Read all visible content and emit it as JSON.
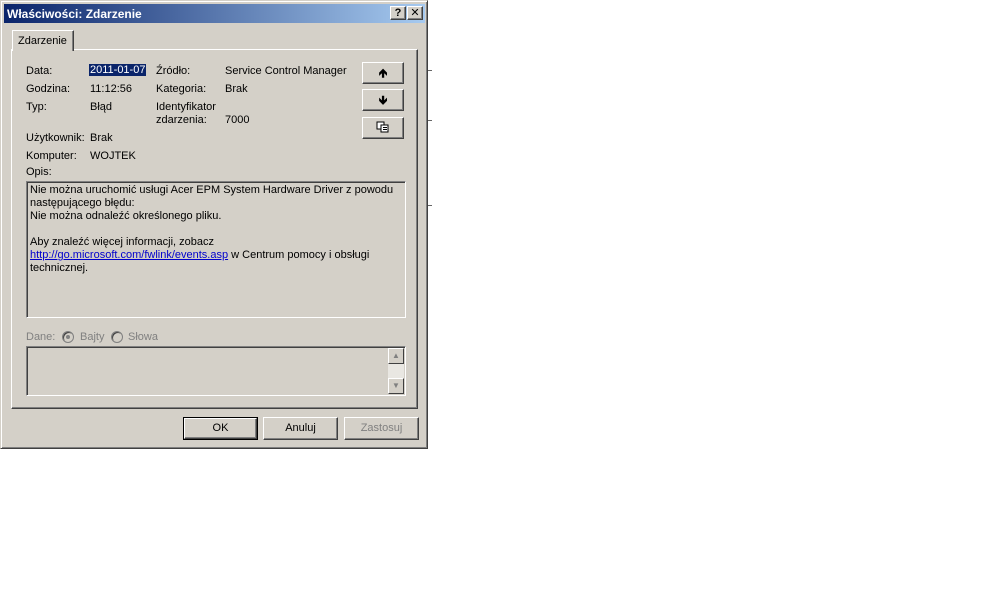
{
  "window": {
    "title": "Właściwości: Zdarzenie",
    "help_label": "?",
    "close_label": "✕"
  },
  "tabs": [
    {
      "label": "Zdarzenie"
    }
  ],
  "event": {
    "date_label": "Data:",
    "date_value": "2011-01-07",
    "time_label": "Godzina:",
    "time_value": "11:12:56",
    "type_label": "Typ:",
    "type_value": "Błąd",
    "user_label": "Użytkownik:",
    "user_value": "Brak",
    "computer_label": "Komputer:",
    "computer_value": "WOJTEK",
    "source_label": "Źródło:",
    "source_value": "Service Control Manager",
    "category_label": "Kategoria:",
    "category_value": "Brak",
    "id_label_line1": "Identyfikator",
    "id_label_line2": "zdarzenia:",
    "id_value": "7000"
  },
  "nav_buttons": {
    "up_icon": "arrow-up-icon",
    "down_icon": "arrow-down-icon",
    "copy_icon": "copy-icon"
  },
  "description": {
    "label": "Opis:",
    "line1": "Nie można uruchomić usługi Acer EPM System Hardware Driver z powodu",
    "line2": "następującego błędu:",
    "line3": "Nie można odnaleźć określonego pliku.",
    "line4": "Aby znaleźć więcej informacji, zobacz",
    "link": "http://go.microsoft.com/fwlink/events.asp",
    "line5_suffix": " w Centrum pomocy i obsługi",
    "line6": "technicznej."
  },
  "data_section": {
    "label": "Dane:",
    "option_bytes": "Bajty",
    "option_words": "Słowa",
    "selected": "Bajty"
  },
  "buttons": {
    "ok": "OK",
    "cancel": "Anuluj",
    "apply": "Zastosuj"
  },
  "colors": {
    "titlebar_start": "#0a246a",
    "titlebar_end": "#a6caf0",
    "face": "#d4d0c8",
    "link": "#0000cc"
  }
}
